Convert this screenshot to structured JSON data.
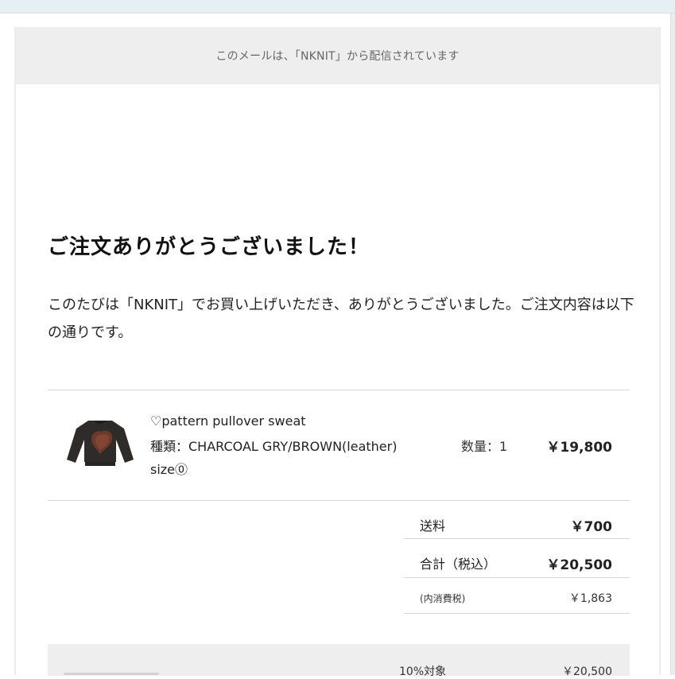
{
  "header": {
    "notice": "このメールは、「NKNIT」から配信されています"
  },
  "message": {
    "title": "ご注文ありがとうございました！",
    "intro": "このたびは「NKNIT」でお買い上げいただき、ありがとうございました。ご注文内容は以下の通りです。"
  },
  "order": {
    "item": {
      "thumbnail": "product-thumbnail",
      "name": "♡pattern pullover sweat",
      "variant": "種類：CHARCOAL GRY/BROWN(leather)",
      "size": "size⓪",
      "quantity": "数量：1",
      "price": "￥19,800"
    },
    "summary": {
      "shipping_label": "送料",
      "shipping_value": "￥700",
      "total_label": "合計（税込）",
      "total_value": "￥20,500",
      "tax_label": "(内消費税)",
      "tax_value": "￥1,863"
    },
    "tax_breakdown": {
      "rate_label": "10%対象",
      "rate_value": "￥20,500"
    }
  },
  "colors": {
    "header_bg": "#eeeeee",
    "text": "#222222",
    "muted": "#666666"
  }
}
